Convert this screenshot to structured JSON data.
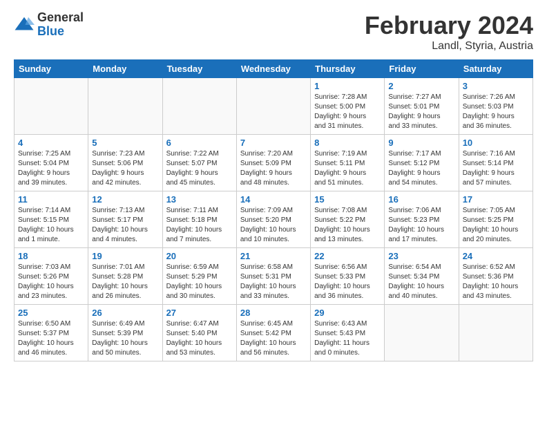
{
  "logo": {
    "general": "General",
    "blue": "Blue"
  },
  "calendar": {
    "title": "February 2024",
    "subtitle": "Landl, Styria, Austria",
    "days": [
      "Sunday",
      "Monday",
      "Tuesday",
      "Wednesday",
      "Thursday",
      "Friday",
      "Saturday"
    ],
    "weeks": [
      [
        {
          "day": "",
          "info": ""
        },
        {
          "day": "",
          "info": ""
        },
        {
          "day": "",
          "info": ""
        },
        {
          "day": "",
          "info": ""
        },
        {
          "day": "1",
          "info": "Sunrise: 7:28 AM\nSunset: 5:00 PM\nDaylight: 9 hours\nand 31 minutes."
        },
        {
          "day": "2",
          "info": "Sunrise: 7:27 AM\nSunset: 5:01 PM\nDaylight: 9 hours\nand 33 minutes."
        },
        {
          "day": "3",
          "info": "Sunrise: 7:26 AM\nSunset: 5:03 PM\nDaylight: 9 hours\nand 36 minutes."
        }
      ],
      [
        {
          "day": "4",
          "info": "Sunrise: 7:25 AM\nSunset: 5:04 PM\nDaylight: 9 hours\nand 39 minutes."
        },
        {
          "day": "5",
          "info": "Sunrise: 7:23 AM\nSunset: 5:06 PM\nDaylight: 9 hours\nand 42 minutes."
        },
        {
          "day": "6",
          "info": "Sunrise: 7:22 AM\nSunset: 5:07 PM\nDaylight: 9 hours\nand 45 minutes."
        },
        {
          "day": "7",
          "info": "Sunrise: 7:20 AM\nSunset: 5:09 PM\nDaylight: 9 hours\nand 48 minutes."
        },
        {
          "day": "8",
          "info": "Sunrise: 7:19 AM\nSunset: 5:11 PM\nDaylight: 9 hours\nand 51 minutes."
        },
        {
          "day": "9",
          "info": "Sunrise: 7:17 AM\nSunset: 5:12 PM\nDaylight: 9 hours\nand 54 minutes."
        },
        {
          "day": "10",
          "info": "Sunrise: 7:16 AM\nSunset: 5:14 PM\nDaylight: 9 hours\nand 57 minutes."
        }
      ],
      [
        {
          "day": "11",
          "info": "Sunrise: 7:14 AM\nSunset: 5:15 PM\nDaylight: 10 hours\nand 1 minute."
        },
        {
          "day": "12",
          "info": "Sunrise: 7:13 AM\nSunset: 5:17 PM\nDaylight: 10 hours\nand 4 minutes."
        },
        {
          "day": "13",
          "info": "Sunrise: 7:11 AM\nSunset: 5:18 PM\nDaylight: 10 hours\nand 7 minutes."
        },
        {
          "day": "14",
          "info": "Sunrise: 7:09 AM\nSunset: 5:20 PM\nDaylight: 10 hours\nand 10 minutes."
        },
        {
          "day": "15",
          "info": "Sunrise: 7:08 AM\nSunset: 5:22 PM\nDaylight: 10 hours\nand 13 minutes."
        },
        {
          "day": "16",
          "info": "Sunrise: 7:06 AM\nSunset: 5:23 PM\nDaylight: 10 hours\nand 17 minutes."
        },
        {
          "day": "17",
          "info": "Sunrise: 7:05 AM\nSunset: 5:25 PM\nDaylight: 10 hours\nand 20 minutes."
        }
      ],
      [
        {
          "day": "18",
          "info": "Sunrise: 7:03 AM\nSunset: 5:26 PM\nDaylight: 10 hours\nand 23 minutes."
        },
        {
          "day": "19",
          "info": "Sunrise: 7:01 AM\nSunset: 5:28 PM\nDaylight: 10 hours\nand 26 minutes."
        },
        {
          "day": "20",
          "info": "Sunrise: 6:59 AM\nSunset: 5:29 PM\nDaylight: 10 hours\nand 30 minutes."
        },
        {
          "day": "21",
          "info": "Sunrise: 6:58 AM\nSunset: 5:31 PM\nDaylight: 10 hours\nand 33 minutes."
        },
        {
          "day": "22",
          "info": "Sunrise: 6:56 AM\nSunset: 5:33 PM\nDaylight: 10 hours\nand 36 minutes."
        },
        {
          "day": "23",
          "info": "Sunrise: 6:54 AM\nSunset: 5:34 PM\nDaylight: 10 hours\nand 40 minutes."
        },
        {
          "day": "24",
          "info": "Sunrise: 6:52 AM\nSunset: 5:36 PM\nDaylight: 10 hours\nand 43 minutes."
        }
      ],
      [
        {
          "day": "25",
          "info": "Sunrise: 6:50 AM\nSunset: 5:37 PM\nDaylight: 10 hours\nand 46 minutes."
        },
        {
          "day": "26",
          "info": "Sunrise: 6:49 AM\nSunset: 5:39 PM\nDaylight: 10 hours\nand 50 minutes."
        },
        {
          "day": "27",
          "info": "Sunrise: 6:47 AM\nSunset: 5:40 PM\nDaylight: 10 hours\nand 53 minutes."
        },
        {
          "day": "28",
          "info": "Sunrise: 6:45 AM\nSunset: 5:42 PM\nDaylight: 10 hours\nand 56 minutes."
        },
        {
          "day": "29",
          "info": "Sunrise: 6:43 AM\nSunset: 5:43 PM\nDaylight: 11 hours\nand 0 minutes."
        },
        {
          "day": "",
          "info": ""
        },
        {
          "day": "",
          "info": ""
        }
      ]
    ]
  }
}
